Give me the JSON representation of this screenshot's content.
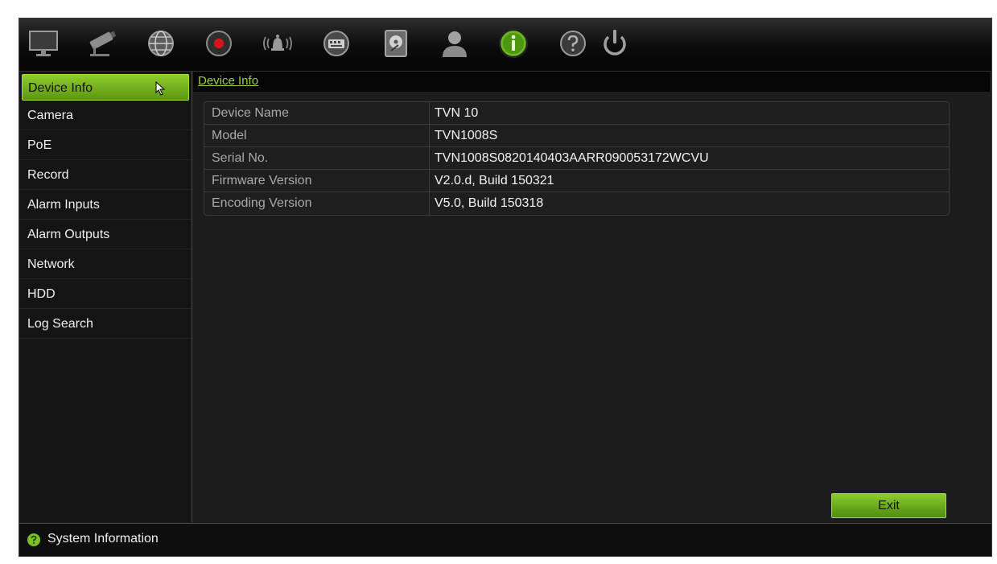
{
  "toolbar": {
    "icons": [
      "display-icon",
      "camera-icon",
      "network-globe-icon",
      "record-icon",
      "alarm-icon",
      "keyboard-icon",
      "hdd-icon",
      "user-icon",
      "info-icon",
      "help-icon",
      "power-icon"
    ],
    "accent_color": "#8fcc2a",
    "record_color": "#d8141a"
  },
  "sidebar": {
    "items": [
      {
        "label": "Device Info",
        "active": true
      },
      {
        "label": "Camera"
      },
      {
        "label": "PoE"
      },
      {
        "label": "Record"
      },
      {
        "label": "Alarm Inputs"
      },
      {
        "label": "Alarm Outputs"
      },
      {
        "label": "Network"
      },
      {
        "label": "HDD"
      },
      {
        "label": "Log Search"
      }
    ]
  },
  "main": {
    "breadcrumb": "Device Info",
    "rows": [
      {
        "key": "Device Name",
        "value": "TVN 10"
      },
      {
        "key": "Model",
        "value": "TVN1008S"
      },
      {
        "key": "Serial No.",
        "value": "TVN1008S0820140403AARR090053172WCVU"
      },
      {
        "key": "Firmware Version",
        "value": "V2.0.d, Build 150321"
      },
      {
        "key": "Encoding Version",
        "value": "V5.0, Build 150318"
      }
    ],
    "exit_label": "Exit"
  },
  "status": {
    "text": "System Information"
  }
}
